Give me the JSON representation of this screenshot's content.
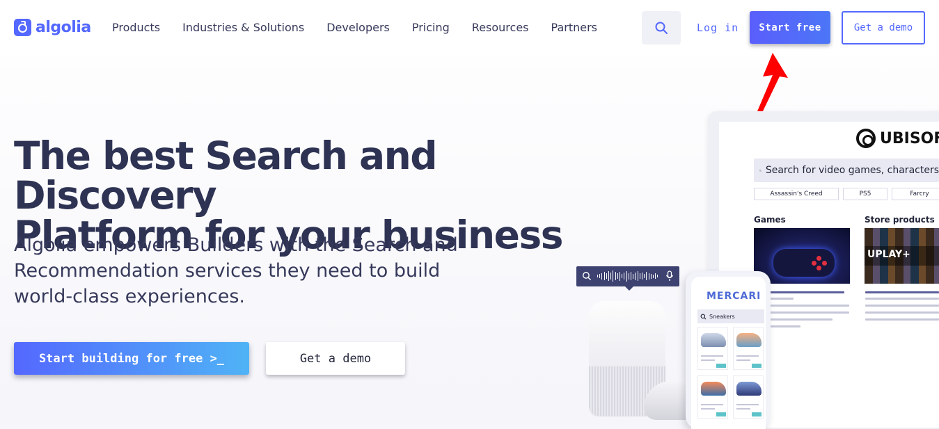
{
  "brand": {
    "name": "algolia",
    "color": "#5468ff"
  },
  "nav": {
    "items": [
      "Products",
      "Industries & Solutions",
      "Developers",
      "Pricing",
      "Resources",
      "Partners"
    ],
    "login_label": "Log in",
    "start_free_label": "Start free",
    "get_demo_label": "Get a demo"
  },
  "hero": {
    "title_line1": "The best Search and Discovery",
    "title_line2": "Platform for your business",
    "subtitle": "Algolia empowers Builders with the Search and Recommendation services they need to build world-class experiences.",
    "primary_cta": "Start building for free >_",
    "secondary_cta": "Get a demo"
  },
  "illustration": {
    "ubisoft_brand": "UBISOFT",
    "search_placeholder": "Search for video games, characters",
    "chips": [
      "Assassin's Creed",
      "PS5",
      "Farcry"
    ],
    "section_games": "Games",
    "section_store": "Store products",
    "uplay_label": "UPLAY+",
    "mercari_brand": "MERCARI",
    "phone_query": "Sneakers"
  },
  "annotation": {
    "arrow_color": "#ff0000"
  }
}
